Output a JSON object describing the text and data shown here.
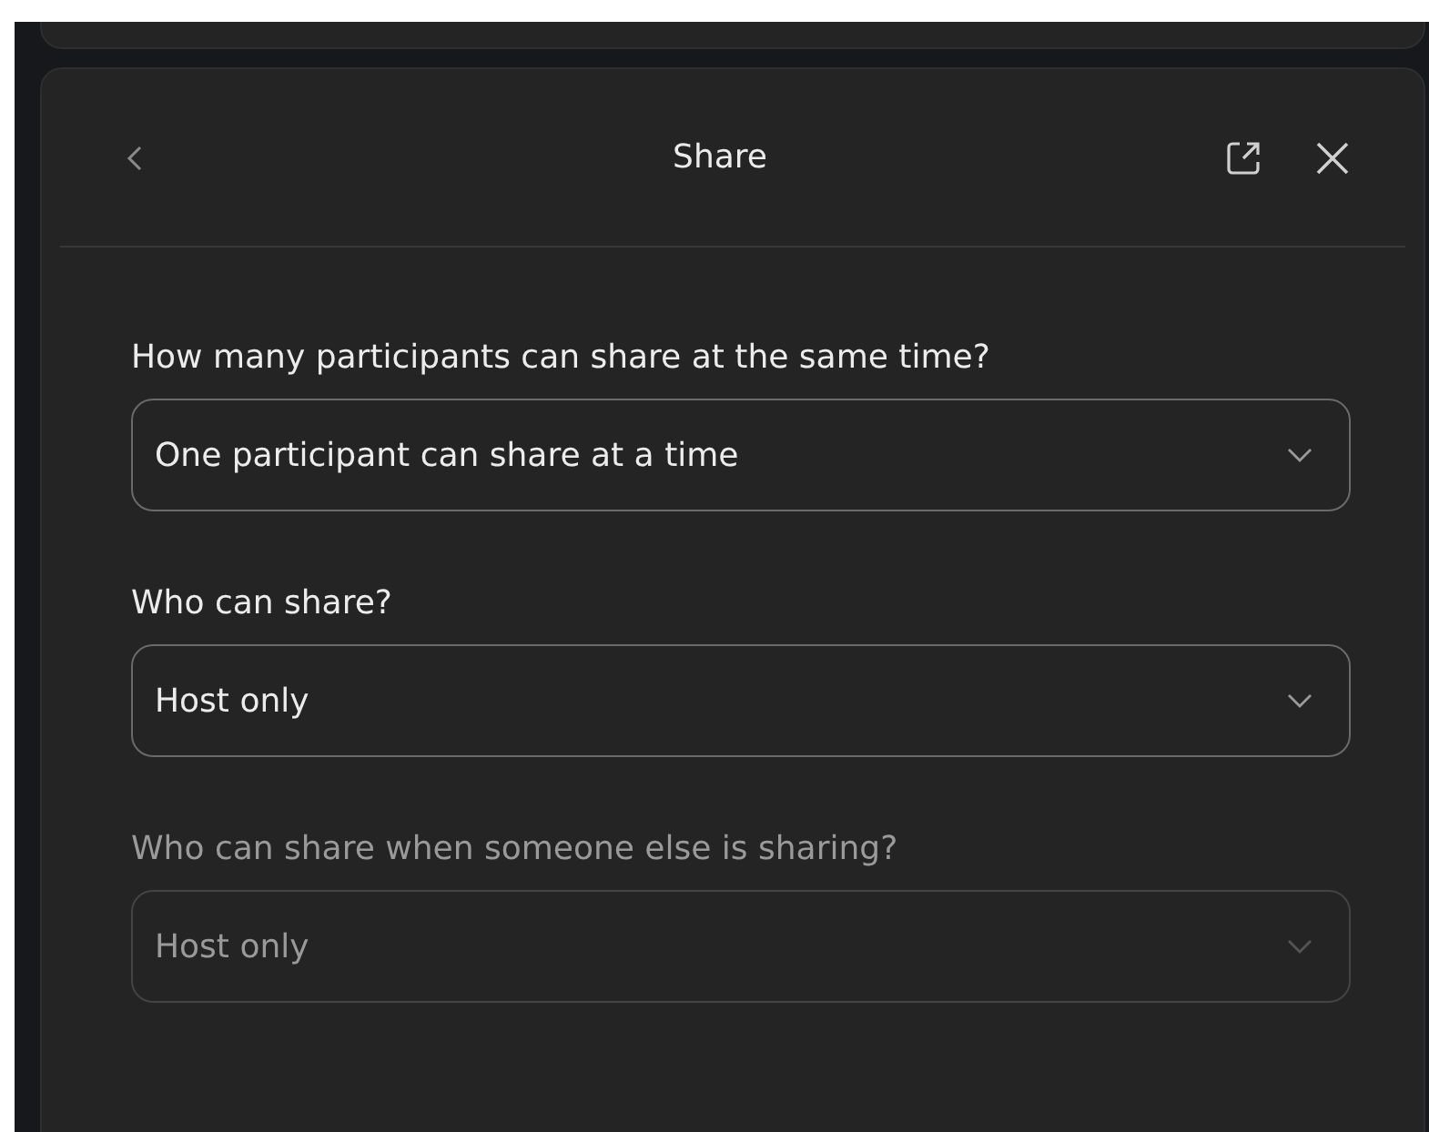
{
  "panel": {
    "title": "Share"
  },
  "settings": [
    {
      "label": "How many participants can share at the same time?",
      "value": "One participant can share at a time",
      "disabled": false
    },
    {
      "label": "Who can share?",
      "value": "Host only",
      "disabled": false
    },
    {
      "label": "Who can share when someone else is sharing?",
      "value": "Host only",
      "disabled": true
    }
  ]
}
